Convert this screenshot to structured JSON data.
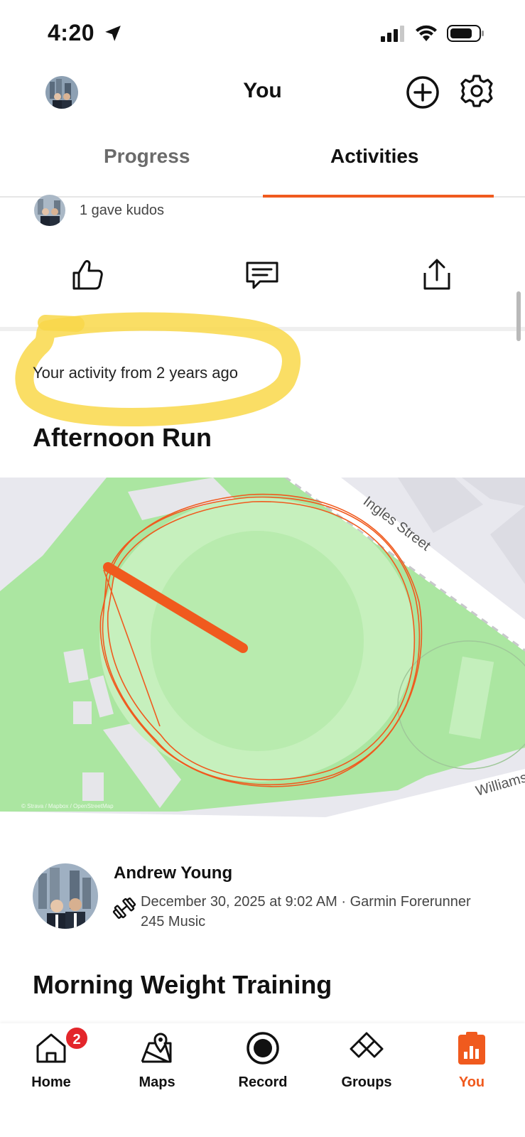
{
  "status_bar": {
    "time": "4:20"
  },
  "header": {
    "title": "You"
  },
  "tabs": [
    {
      "label": "Progress",
      "active": false
    },
    {
      "label": "Activities",
      "active": true
    }
  ],
  "kudos": {
    "text": "1 gave kudos"
  },
  "memory": {
    "text": "Your activity from 2 years ago"
  },
  "activity": {
    "title": "Afternoon Run"
  },
  "map": {
    "street_1": "Ingles Street",
    "street_2": "Williams",
    "attribution": "© Strava / Mapbox / OpenStreetMap",
    "route_color": "#f05a1e"
  },
  "athlete": {
    "name": "Andrew Young",
    "meta": "December 30, 2025 at 9:02 AM · Garmin Forerunner 245 Music",
    "activity_icon": "dumbbell-icon"
  },
  "next_activity": {
    "title": "Morning Weight Training"
  },
  "bottom_nav": [
    {
      "label": "Home",
      "icon": "home-icon",
      "badge": "2"
    },
    {
      "label": "Maps",
      "icon": "maps-icon"
    },
    {
      "label": "Record",
      "icon": "record-icon"
    },
    {
      "label": "Groups",
      "icon": "groups-icon"
    },
    {
      "label": "You",
      "icon": "you-icon",
      "active": true
    }
  ],
  "colors": {
    "accent": "#f05a1e",
    "highlight": "#f9d84a",
    "badge": "#e3262b"
  }
}
